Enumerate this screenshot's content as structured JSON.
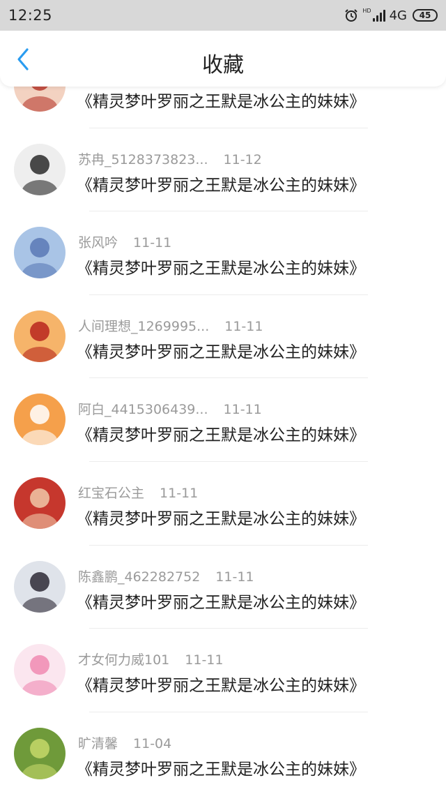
{
  "status_bar": {
    "time": "12:25",
    "network": "4G",
    "hd": "HD",
    "battery": "45"
  },
  "header": {
    "title": "收藏"
  },
  "items": [
    {
      "user": "",
      "date": "",
      "content": "《精灵梦叶罗丽之王默是冰公主的妹妹》",
      "avatar_colors": [
        "#f3d2c1",
        "#b83a2e"
      ]
    },
    {
      "user": "苏冉_5128373823...",
      "date": "11-12",
      "content": "《精灵梦叶罗丽之王默是冰公主的妹妹》",
      "avatar_colors": [
        "#eeeeee",
        "#2a2a2a"
      ]
    },
    {
      "user": "张风吟",
      "date": "11-11",
      "content": "《精灵梦叶罗丽之王默是冰公主的妹妹》",
      "avatar_colors": [
        "#a9c4e6",
        "#5a79b5"
      ]
    },
    {
      "user": "人间理想_1269995...",
      "date": "11-11",
      "content": "《精灵梦叶罗丽之王默是冰公主的妹妹》",
      "avatar_colors": [
        "#f6b46a",
        "#b8261d"
      ]
    },
    {
      "user": "阿白_4415306439...",
      "date": "11-11",
      "content": "《精灵梦叶罗丽之王默是冰公主的妹妹》",
      "avatar_colors": [
        "#f5a04b",
        "#ffffff"
      ]
    },
    {
      "user": "红宝石公主",
      "date": "11-11",
      "content": "《精灵梦叶罗丽之王默是冰公主的妹妹》",
      "avatar_colors": [
        "#c6372d",
        "#f0c8a8"
      ]
    },
    {
      "user": "陈鑫鹏_462282752",
      "date": "11-11",
      "content": "《精灵梦叶罗丽之王默是冰公主的妹妹》",
      "avatar_colors": [
        "#dfe3ea",
        "#2e2a36"
      ]
    },
    {
      "user": "才女何力威101",
      "date": "11-11",
      "content": "《精灵梦叶罗丽之王默是冰公主的妹妹》",
      "avatar_colors": [
        "#fbe6ef",
        "#f08ab2"
      ]
    },
    {
      "user": "旷清馨",
      "date": "11-04",
      "content": "《精灵梦叶罗丽之王默是冰公主的妹妹》",
      "avatar_colors": [
        "#6f9a3a",
        "#c6d86a"
      ]
    }
  ]
}
